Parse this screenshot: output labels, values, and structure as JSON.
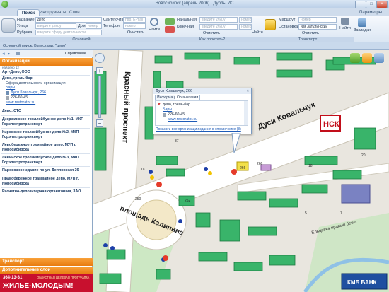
{
  "window": {
    "title": "Новосибирск (апрель 2006) · ДубльГИС",
    "logo_text": "ДубльГИС",
    "params_label": "Параметры"
  },
  "menu_tabs": [
    "Поиск",
    "Инструменты",
    "Слои"
  ],
  "ribbon": {
    "main_group": {
      "caption": "Основной",
      "name_label": "Название",
      "name_value": "депо",
      "street_label": "Улица",
      "street_placeholder": "введите улицу",
      "house_label": "Дом",
      "house_placeholder": "номер",
      "rubric_label": "Рубрика",
      "rubric_placeholder": "введите сферу деятельности",
      "site_label": "Сайт/почта",
      "site_placeholder": "http, E-mail",
      "phone_label": "Телефон",
      "phone_placeholder": "номер",
      "find_button": "Найти",
      "clear_button": "Очистить"
    },
    "route_group": {
      "caption": "Как проехать?",
      "start_label": "Начальная",
      "end_label": "Конечная",
      "street_placeholder": "введите улицу",
      "house_placeholder": "номер",
      "find_button": "Найти",
      "clear_button": "Очистить"
    },
    "transport_group": {
      "caption": "Транспорт",
      "route_label": "Маршрут",
      "route_placeholder": "номер",
      "stop_label": "Остановка",
      "stop_value": "и/м Затулинский",
      "find_button": "Найти",
      "clear_button": "Очистить",
      "bookmarks_button": "Закладки"
    }
  },
  "search_status": "Основной поиск. Вы искали: \"депо\"",
  "left_panel": {
    "toolbar_label": "Справочник",
    "org_header": "Организации",
    "org_count": "найдено 12",
    "orgs": [
      {
        "name": "Арт-Депо, ООО"
      },
      {
        "name": "Депо, гриль-бар",
        "sub": "Сфера деятельности организации",
        "rubric": "Бары",
        "address": "Дуси Ковальчук, 266",
        "phone": "226-60-45",
        "site": "www.restorator.su"
      },
      {
        "name": "Депо, СТО"
      },
      {
        "name": "Дзержинское троллейбусное депо №1, МКП Горэлектротранспорт"
      },
      {
        "name": "Кировское троллейбусное депо №2, МКП Горэлектротранспорт"
      },
      {
        "name": "Левобережное трамвайное депо, МУП г. Новосибирска"
      },
      {
        "name": "Ленинское троллейбусное депо №3, МКП Горэлектротранспорт"
      },
      {
        "name": "Паровозное здание по ул. Депповская 36"
      },
      {
        "name": "Правобережное трамвайное депо, МУП г. Новосибирска"
      },
      {
        "name": "Расчетно-депозитарная организация, ЗАО"
      }
    ],
    "transport_header": "Транспорт",
    "layers_header": "Дополнительные слои",
    "ad_phone": "364-13-31",
    "ad_small": "ОБЛАСТНАЯ ЦЕЛЕВАЯ ПРОГРАММА",
    "ad_big": "ЖИЛЬЕ-МОЛОДЫМ!"
  },
  "map": {
    "street_labels": [
      "Красный проспект",
      "Дуси Ковальчук",
      "площадь Калинина",
      "Ельцовка правый берег"
    ],
    "badge": "НСК",
    "bank": "КМБ БАНК",
    "numbers": [
      "266",
      "268",
      "1a",
      "18",
      "20",
      "250",
      "252",
      "5",
      "7",
      "87"
    ],
    "popup": {
      "title": "Дуси Ковальчук, 266",
      "tabs": [
        "Информация",
        "Организации"
      ],
      "org_name": "депо, гриль-бар",
      "rubric": "Бары",
      "phone": "226-60-45",
      "site": "www.restorator.su",
      "footer_link": "Показать все организации здания в справочнике (8)"
    }
  }
}
